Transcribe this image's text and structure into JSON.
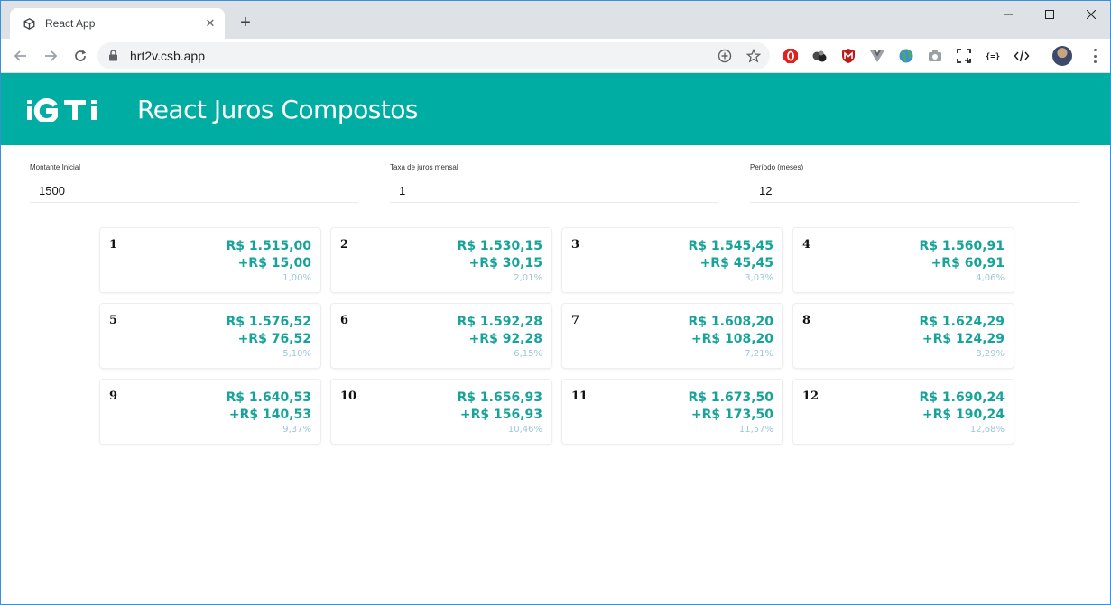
{
  "browser": {
    "tab_title": "React App",
    "url": "hrt2v.csb.app"
  },
  "app": {
    "logo_text": "iGTi",
    "title": "React Juros Compostos",
    "colors": {
      "header": "#00ada2",
      "value": "#15a39a",
      "percent": "#9cc6d9"
    }
  },
  "form": {
    "initial_label": "Montante Inicial",
    "initial_value": "1500",
    "rate_label": "Taxa de juros mensal",
    "rate_value": "1",
    "period_label": "Período (meses)",
    "period_value": "12"
  },
  "installments": [
    {
      "month": "1",
      "total": "R$ 1.515,00",
      "gain": "+R$ 15,00",
      "percent": "1,00%"
    },
    {
      "month": "2",
      "total": "R$ 1.530,15",
      "gain": "+R$ 30,15",
      "percent": "2,01%"
    },
    {
      "month": "3",
      "total": "R$ 1.545,45",
      "gain": "+R$ 45,45",
      "percent": "3,03%"
    },
    {
      "month": "4",
      "total": "R$ 1.560,91",
      "gain": "+R$ 60,91",
      "percent": "4,06%"
    },
    {
      "month": "5",
      "total": "R$ 1.576,52",
      "gain": "+R$ 76,52",
      "percent": "5,10%"
    },
    {
      "month": "6",
      "total": "R$ 1.592,28",
      "gain": "+R$ 92,28",
      "percent": "6,15%"
    },
    {
      "month": "7",
      "total": "R$ 1.608,20",
      "gain": "+R$ 108,20",
      "percent": "7,21%"
    },
    {
      "month": "8",
      "total": "R$ 1.624,29",
      "gain": "+R$ 124,29",
      "percent": "8,29%"
    },
    {
      "month": "9",
      "total": "R$ 1.640,53",
      "gain": "+R$ 140,53",
      "percent": "9,37%"
    },
    {
      "month": "10",
      "total": "R$ 1.656,93",
      "gain": "+R$ 156,93",
      "percent": "10,46%"
    },
    {
      "month": "11",
      "total": "R$ 1.673,50",
      "gain": "+R$ 173,50",
      "percent": "11,57%"
    },
    {
      "month": "12",
      "total": "R$ 1.690,24",
      "gain": "+R$ 190,24",
      "percent": "12,68%"
    }
  ]
}
